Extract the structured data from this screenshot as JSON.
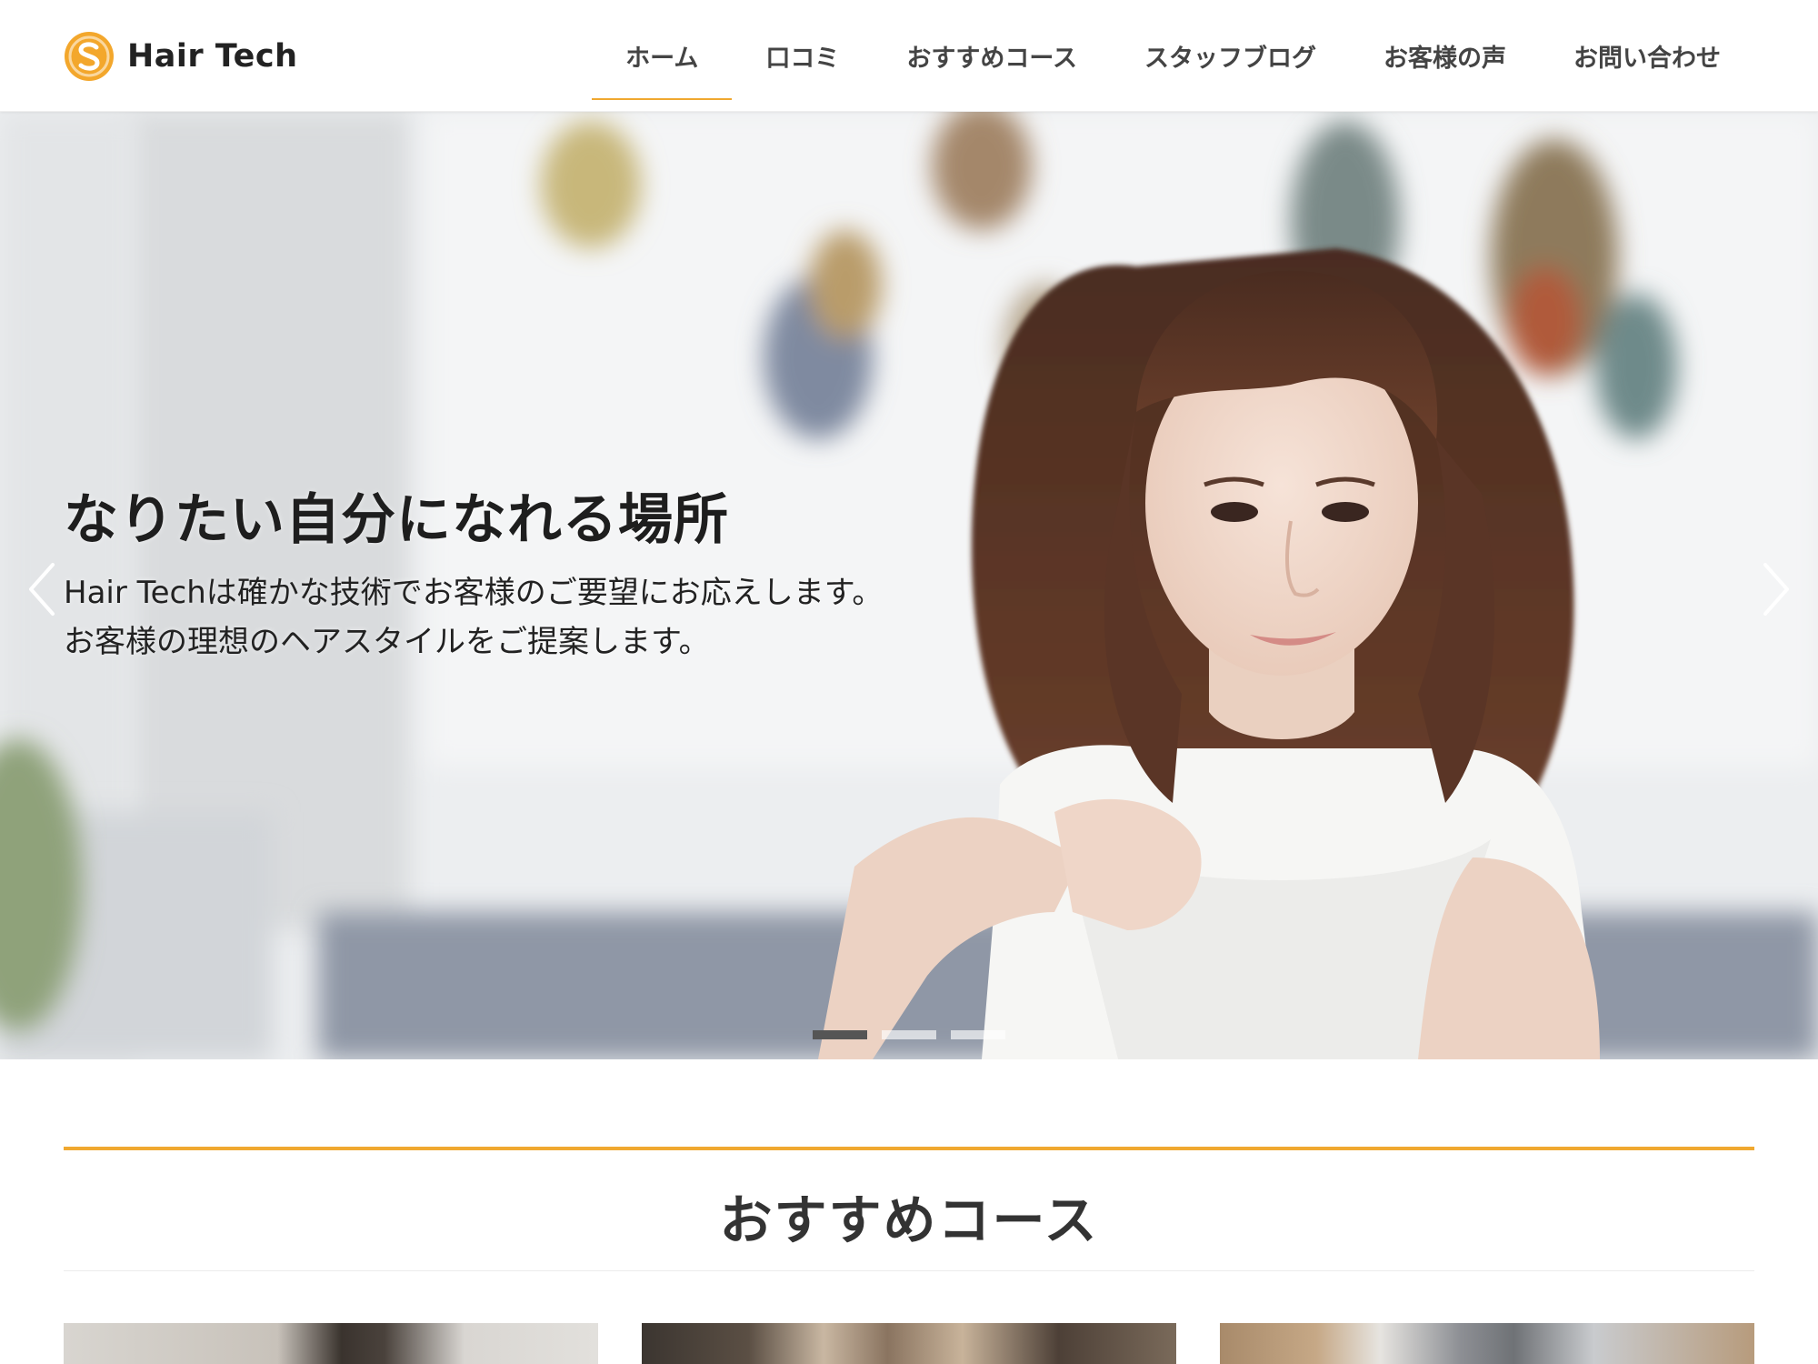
{
  "header": {
    "logo_text": "Hair Tech",
    "logo_icon": "coin-s-icon",
    "brand_color": "#f0a830",
    "nav": [
      {
        "label": "ホーム",
        "active": true
      },
      {
        "label": "口コミ",
        "active": false
      },
      {
        "label": "おすすめコース",
        "active": false
      },
      {
        "label": "スタッフブログ",
        "active": false
      },
      {
        "label": "お客様の声",
        "active": false
      },
      {
        "label": "お問い合わせ",
        "active": false
      }
    ]
  },
  "hero": {
    "title": "なりたい自分になれる場所",
    "subtitle_line1": "Hair Techは確かな技術でお客様のご要望にお応えします。",
    "subtitle_line2": "お客様の理想のヘアスタイルをご提案します。",
    "prev_icon": "chevron-left-icon",
    "next_icon": "chevron-right-icon",
    "slides_count": 3,
    "active_slide": 1
  },
  "section": {
    "title": "おすすめコース",
    "accent_color": "#f0a830"
  }
}
